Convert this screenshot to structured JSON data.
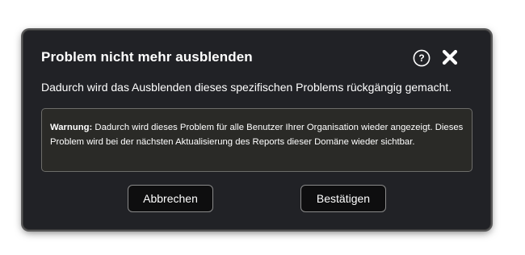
{
  "dialog": {
    "title": "Problem nicht mehr ausblenden",
    "description": "Dadurch wird das Ausblenden dieses spezifischen Problems rückgängig gemacht.",
    "warning_label": "Warnung:",
    "warning_text": " Dadurch wird dieses Problem für alle Benutzer Ihrer Organisation wieder angezeigt. Dieses Problem wird bei der nächsten Aktualisierung des Reports dieser Domäne wieder sichtbar.",
    "cancel_label": "Abbrechen",
    "confirm_label": "Bestätigen",
    "icons": {
      "help": "help-icon",
      "close": "close-icon"
    }
  },
  "colors": {
    "dialog_bg": "#212226",
    "warning_bg": "#2a2a27",
    "button_bg": "#0e0e0f",
    "text": "#ffffff"
  }
}
